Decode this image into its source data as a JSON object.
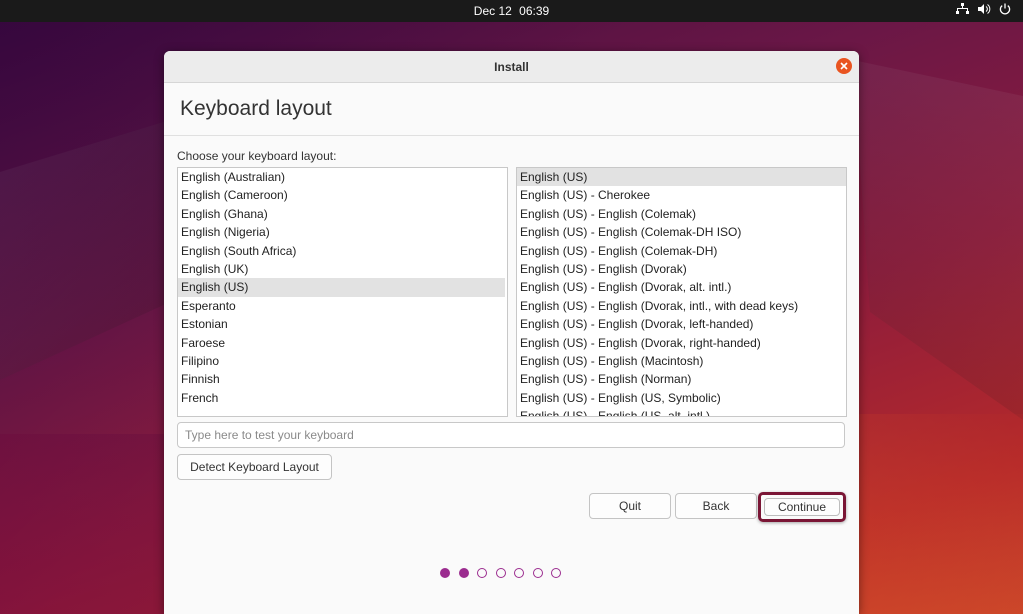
{
  "topbar": {
    "date": "Dec 12",
    "time": "06:39",
    "icons": [
      "network-icon",
      "volume-icon",
      "power-icon"
    ]
  },
  "window": {
    "title": "Install",
    "close_icon": "close-icon"
  },
  "page": {
    "heading": "Keyboard layout",
    "prompt": "Choose your keyboard layout:"
  },
  "layouts": [
    {
      "label": "English (Australian)",
      "selected": false
    },
    {
      "label": "English (Cameroon)",
      "selected": false
    },
    {
      "label": "English (Ghana)",
      "selected": false
    },
    {
      "label": "English (Nigeria)",
      "selected": false
    },
    {
      "label": "English (South Africa)",
      "selected": false
    },
    {
      "label": "English (UK)",
      "selected": false
    },
    {
      "label": "English (US)",
      "selected": true
    },
    {
      "label": "Esperanto",
      "selected": false
    },
    {
      "label": "Estonian",
      "selected": false
    },
    {
      "label": "Faroese",
      "selected": false
    },
    {
      "label": "Filipino",
      "selected": false
    },
    {
      "label": "Finnish",
      "selected": false
    },
    {
      "label": "French",
      "selected": false
    }
  ],
  "variants": [
    {
      "label": "English (US)",
      "selected": true
    },
    {
      "label": "English (US) - Cherokee",
      "selected": false
    },
    {
      "label": "English (US) - English (Colemak)",
      "selected": false
    },
    {
      "label": "English (US) - English (Colemak-DH ISO)",
      "selected": false
    },
    {
      "label": "English (US) - English (Colemak-DH)",
      "selected": false
    },
    {
      "label": "English (US) - English (Dvorak)",
      "selected": false
    },
    {
      "label": "English (US) - English (Dvorak, alt. intl.)",
      "selected": false
    },
    {
      "label": "English (US) - English (Dvorak, intl., with dead keys)",
      "selected": false
    },
    {
      "label": "English (US) - English (Dvorak, left-handed)",
      "selected": false
    },
    {
      "label": "English (US) - English (Dvorak, right-handed)",
      "selected": false
    },
    {
      "label": "English (US) - English (Macintosh)",
      "selected": false
    },
    {
      "label": "English (US) - English (Norman)",
      "selected": false
    },
    {
      "label": "English (US) - English (US, Symbolic)",
      "selected": false
    },
    {
      "label": "English (US) - English (US, alt. intl.)",
      "selected": false
    }
  ],
  "test_input": {
    "value": "",
    "placeholder": "Type here to test your keyboard"
  },
  "buttons": {
    "detect": "Detect Keyboard Layout",
    "quit": "Quit",
    "back": "Back",
    "continue": "Continue"
  },
  "progress": {
    "total_steps": 7,
    "completed_steps": 2
  },
  "colors": {
    "accent": "#e95420",
    "progress": "#9b2c8f",
    "continue_highlight": "#7a1535"
  }
}
